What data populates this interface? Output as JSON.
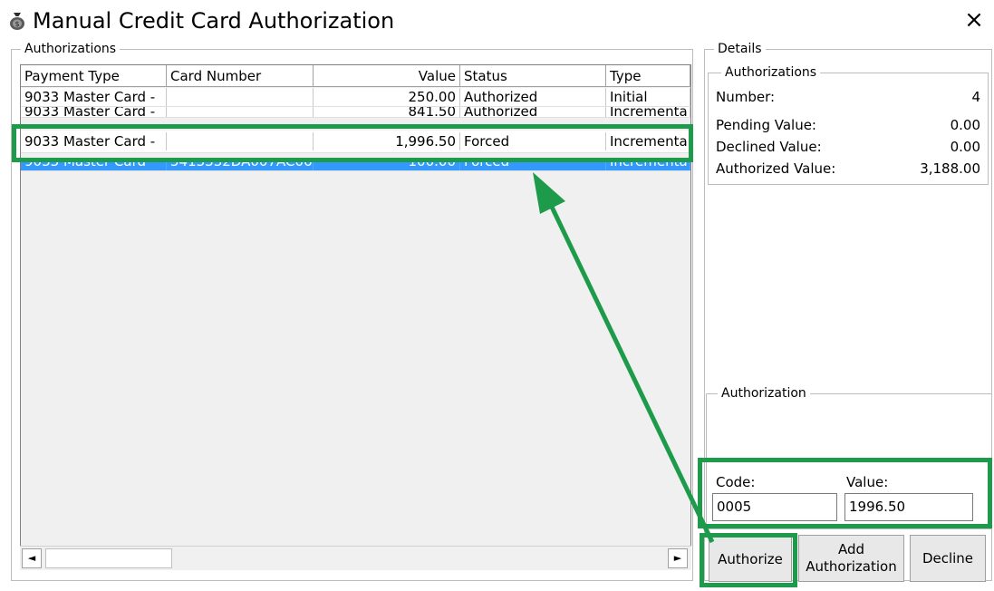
{
  "window": {
    "title": "Manual Credit Card Authorization",
    "close_glyph": "×",
    "icon": "money-bag-icon"
  },
  "authorizations_group": {
    "legend": "Authorizations",
    "columns": [
      "Payment Type",
      "Card Number",
      "Value",
      "Status",
      "Type"
    ],
    "rows": [
      {
        "payment_type": "9033 Master Card -",
        "card_number": "",
        "value": "250.00",
        "status": "Authorized",
        "type": "Initial"
      },
      {
        "payment_type": "9033 Master Card -",
        "card_number": "",
        "value": "841.50",
        "status": "Authorized",
        "type": "Incrementa"
      },
      {
        "payment_type": "9033 Master Card -",
        "card_number": "",
        "value": "1,996.50",
        "status": "Forced",
        "type": "Incrementa"
      },
      {
        "payment_type": "9033 Master Card",
        "card_number": "5413332DA007AC06E",
        "value": "100.00",
        "status": "Forced",
        "type": "Incrementa"
      }
    ],
    "selected_row_index": 3,
    "scroll_left_glyph": "◄",
    "scroll_right_glyph": "►"
  },
  "details_group": {
    "legend": "Details",
    "authorizations_legend": "Authorizations",
    "number_label": "Number:",
    "number_value": "4",
    "pending_label": "Pending Value:",
    "pending_value": "0.00",
    "declined_label": "Declined Value:",
    "declined_value": "0.00",
    "authorized_label": "Authorized Value:",
    "authorized_value": "3,188.00"
  },
  "authorization_group": {
    "legend": "Authorization",
    "code_label": "Code:",
    "code_value": "0005",
    "value_label": "Value:",
    "value_value": "1996.50"
  },
  "buttons": {
    "authorize": "Authorize",
    "add_authorization_line1": "Add",
    "add_authorization_line2": "Authorization",
    "decline": "Decline"
  },
  "annotation": {
    "highlight_color": "#1e9a4b"
  }
}
